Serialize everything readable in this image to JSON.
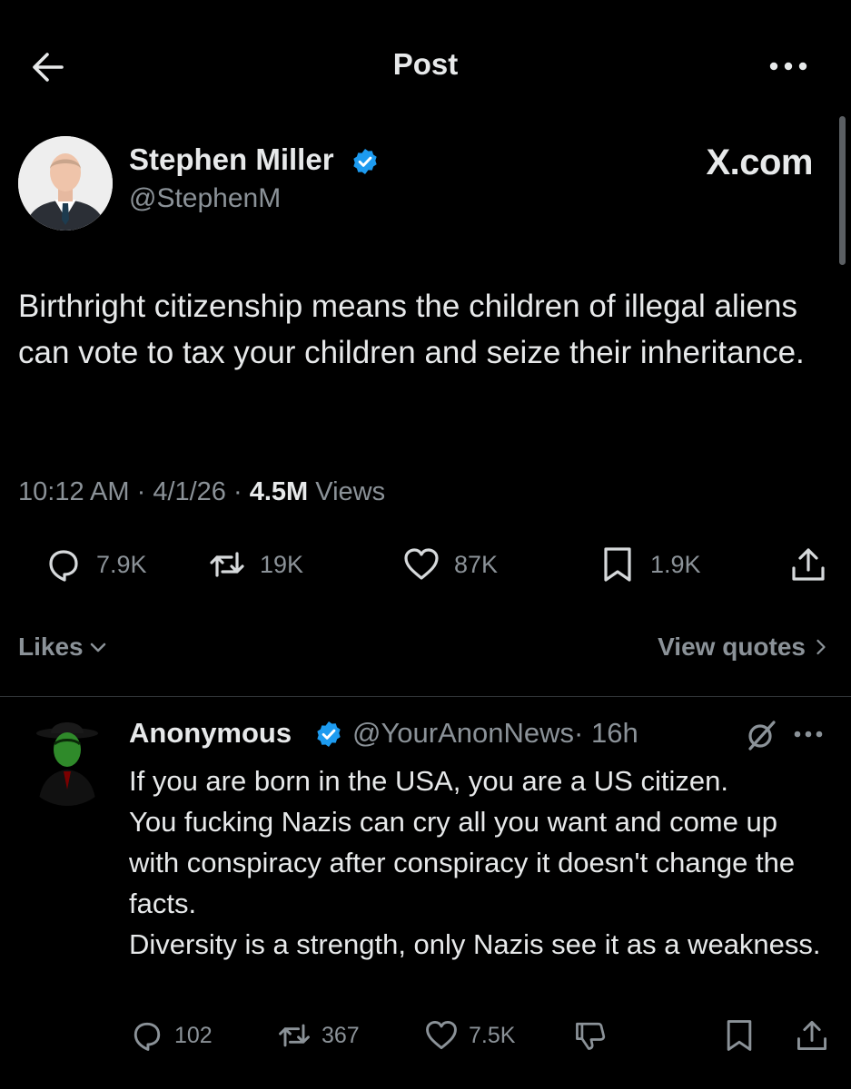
{
  "header": {
    "title": "Post"
  },
  "post": {
    "author": {
      "name": "Stephen Miller",
      "handle": "@StephenM"
    },
    "watermark": "X.com",
    "text": "Birthright citizenship means the children of illegal aliens can vote to tax your children and seize their inheritance.",
    "meta": {
      "time": "10:12 AM",
      "sep1": " · ",
      "date": "4/1/26",
      "sep2": " · ",
      "views_count": "4.5M",
      "views_label": " Views"
    },
    "stats": {
      "replies": "7.9K",
      "reposts": "19K",
      "likes": "87K",
      "bookmarks": "1.9K"
    },
    "likes_label": "Likes",
    "quotes_label": "View quotes"
  },
  "reply": {
    "author": {
      "name": "Anonymous",
      "handle": "@YourAnonNews",
      "time": "· 16h"
    },
    "text": "If you are born in the USA, you are a US citizen.\nYou fucking Nazis can cry all you want and come up with conspiracy after conspiracy it doesn't change the facts.\nDiversity is a strength, only Nazis see it as a weakness.",
    "stats": {
      "replies": "102",
      "reposts": "367",
      "likes": "7.5K"
    }
  },
  "icons": {
    "back": "arrow-left-icon",
    "more": "more-horizontal-icon",
    "verified": "verified-badge-icon",
    "reply": "reply-icon",
    "repost": "repost-icon",
    "like": "heart-icon",
    "bookmark": "bookmark-icon",
    "share": "share-icon",
    "chevron_down": "chevron-down-icon",
    "chevron_right": "chevron-right-icon",
    "grok": "grok-icon",
    "dislike": "thumbs-down-icon"
  },
  "colors": {
    "background": "#000000",
    "text": "#e7e9ea",
    "secondary": "#8b9298",
    "verified": "#1d9bf0",
    "divider": "#2f3336"
  }
}
